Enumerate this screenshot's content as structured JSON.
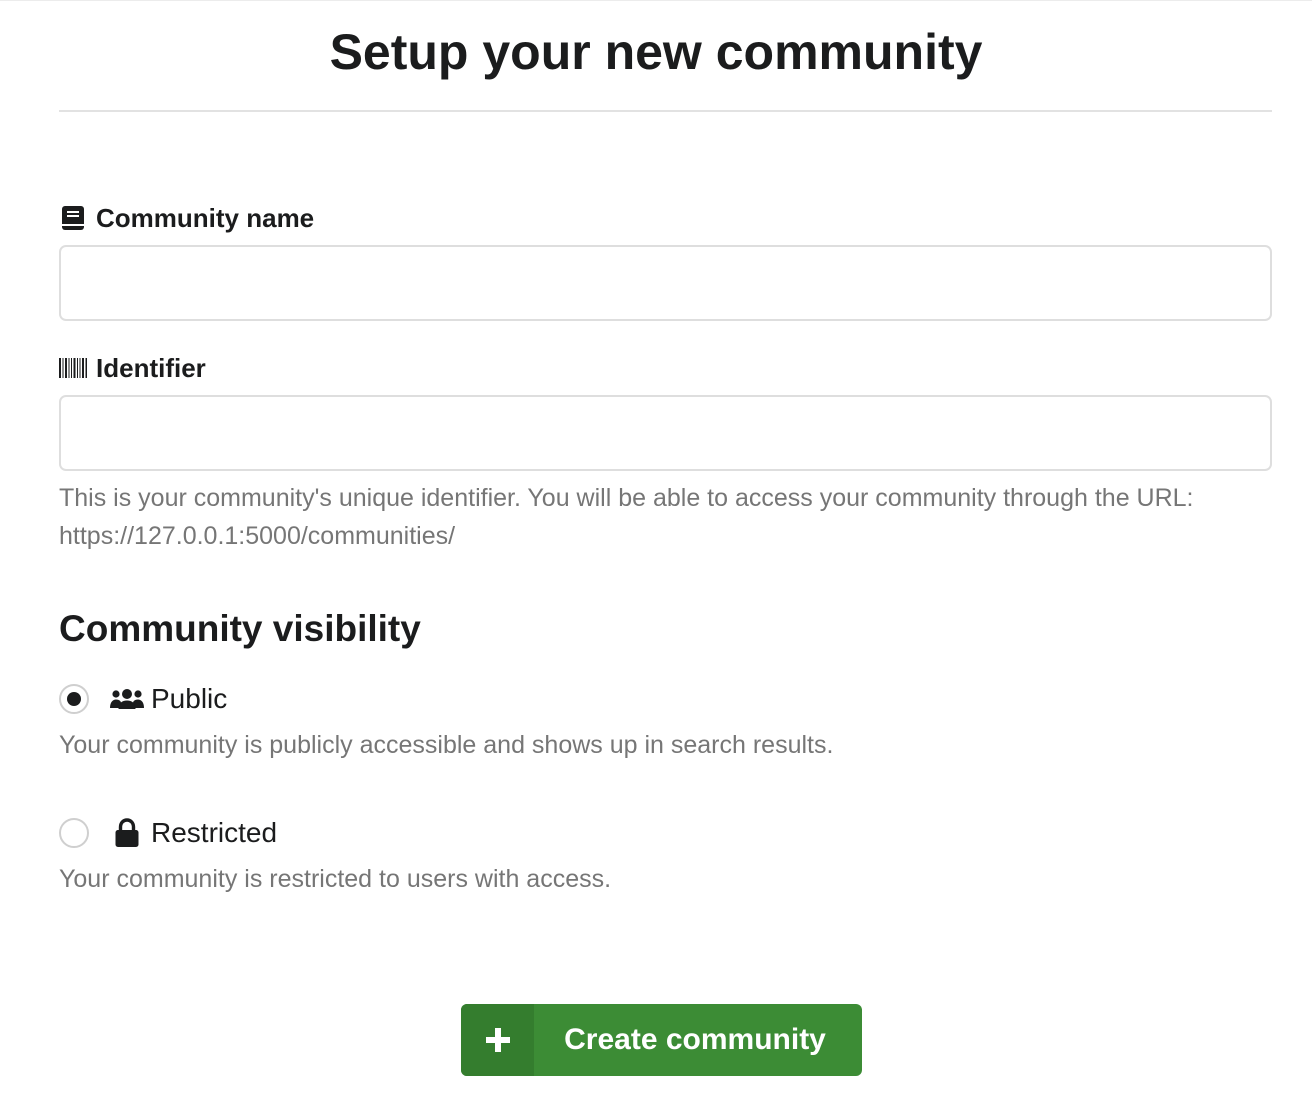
{
  "page": {
    "title": "Setup your new community"
  },
  "form": {
    "name_field": {
      "label": "Community name",
      "icon": "book-icon",
      "value": "",
      "placeholder": ""
    },
    "identifier_field": {
      "label": "Identifier",
      "icon": "barcode-icon",
      "value": "",
      "placeholder": "",
      "help_text": "This is your community's unique identifier. You will be able to access your community through the URL:",
      "help_url": "https://127.0.0.1:5000/communities/"
    },
    "visibility": {
      "heading": "Community visibility",
      "options": [
        {
          "label": "Public",
          "icon": "users-icon",
          "selected": true,
          "description": "Your community is publicly accessible and shows up in search results."
        },
        {
          "label": "Restricted",
          "icon": "lock-icon",
          "selected": false,
          "description": "Your community is restricted to users with access."
        }
      ]
    },
    "submit": {
      "label": "Create community",
      "icon": "plus-icon",
      "color": "#3c8c35"
    }
  }
}
